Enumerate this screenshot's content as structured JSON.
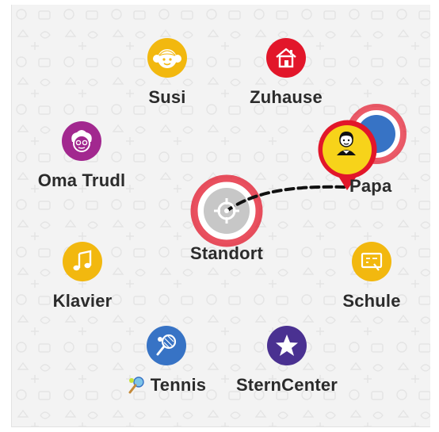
{
  "places": {
    "susi": {
      "label": "Susi",
      "icon": "girl-face-icon"
    },
    "zuhause": {
      "label": "Zuhause",
      "icon": "house-icon"
    },
    "oma_trudl": {
      "label": "Oma Trudl",
      "icon": "grandma-face-icon"
    },
    "papa": {
      "label": "Papa",
      "icon": "man-avatar-pin-icon"
    },
    "standort": {
      "label": "Standort",
      "icon": "crosshair-icon"
    },
    "klavier": {
      "label": "Klavier",
      "icon": "music-note-icon"
    },
    "schule": {
      "label": "Schule",
      "icon": "school-board-icon"
    },
    "tennis": {
      "label": "Tennis",
      "icon": "tennis-racket-icon"
    },
    "sterncenter": {
      "label": "SternCenter",
      "icon": "star-icon"
    }
  },
  "colors": {
    "yellow": "#f2b80f",
    "red": "#e2162a",
    "purple": "#a2288f",
    "blue": "#3773c5",
    "violet": "#4a3191",
    "route": "#111111"
  }
}
